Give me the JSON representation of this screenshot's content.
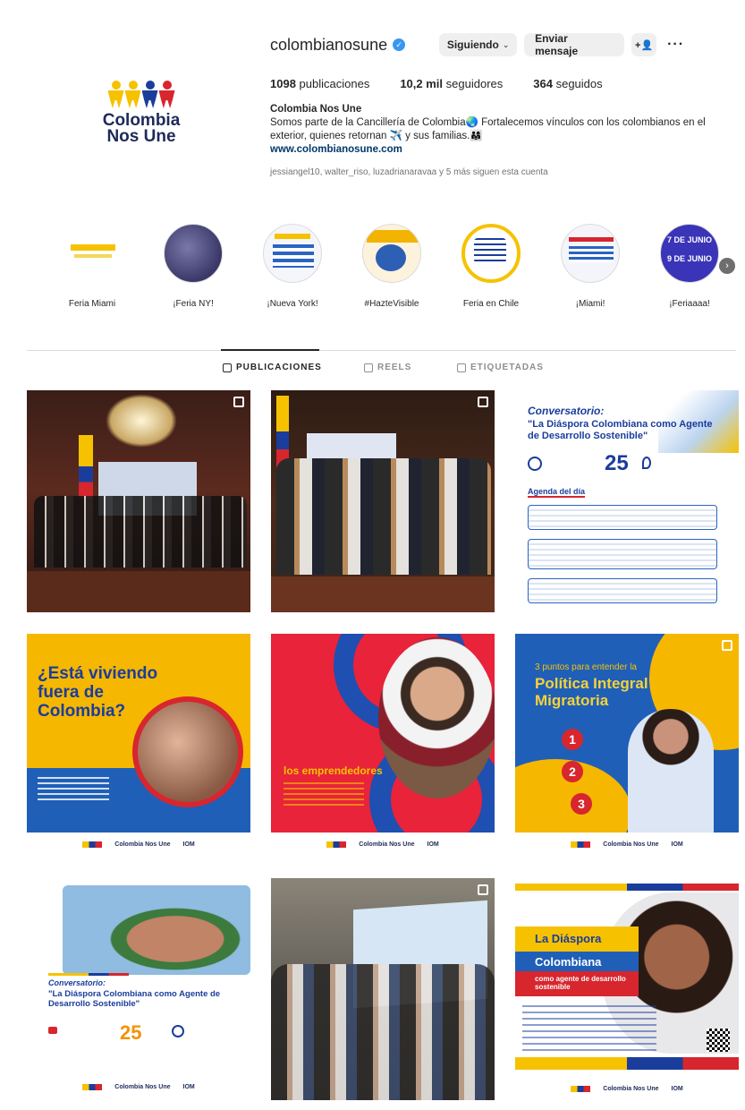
{
  "profile": {
    "username": "colombianosune",
    "follow_button": "Siguiendo",
    "message_button": "Enviar mensaje",
    "add_person_icon": "person-add-icon",
    "more_icon": "more-icon",
    "avatar_text_line1": "Colombia",
    "avatar_text_line2": "Nos Une",
    "stats": {
      "posts_count": "1098",
      "posts_label": "publicaciones",
      "followers_count": "10,2 mil",
      "followers_label": "seguidores",
      "following_count": "364",
      "following_label": "seguidos"
    },
    "bio_name": "Colombia Nos Une",
    "bio_text": "Somos parte de la Cancillería de Colombia🌏 Fortalecemos vínculos con los colombianos en el exterior, quienes retornan ✈️ y sus familias.👨‍👩‍👧",
    "bio_link": "www.colombianosune.com",
    "followed_by": "jessiangel10, walter_riso, luzadrianaravaa y 5 más siguen esta cuenta"
  },
  "highlights": [
    {
      "label": "Feria Miami"
    },
    {
      "label": "¡Feria NY!"
    },
    {
      "label": "¡Nueva York!"
    },
    {
      "label": "#HazteVisible"
    },
    {
      "label": "Feria en Chile"
    },
    {
      "label": "¡Miami!"
    },
    {
      "label": "¡Feriaaaa!"
    }
  ],
  "highlight_texts": {
    "h7_line1": "7 DE JUNIO",
    "h7_line2": "9 DE JUNIO"
  },
  "tabs": [
    {
      "label": "PUBLICACIONES",
      "icon": "grid-icon"
    },
    {
      "label": "REELS",
      "icon": "reels-icon"
    },
    {
      "label": "ETIQUETADAS",
      "icon": "tagged-icon"
    }
  ],
  "posts": {
    "p3_title_label": "Conversatorio:",
    "p3_title": "\"La Diáspora Colombiana como Agente de Desarrollo Sostenible\"",
    "p3_date_num": "25",
    "p3_agenda": "Agenda del día",
    "p4_title": "¿Está viviendo fuera de Colombia?",
    "p5_title": "los emprendedores",
    "p6_title_small": "3 puntos para entender la",
    "p6_title": "Política Integral Migratoria",
    "p6_n1": "1",
    "p6_n2": "2",
    "p6_n3": "3",
    "p7_title_label": "Conversatorio:",
    "p7_title": "\"La Diáspora Colombiana como Agente de Desarrollo Sostenible\"",
    "p7_date_num": "25",
    "p9_title1": "La Diáspora",
    "p9_title2": "Colombiana",
    "p9_title3": "como agente de desarrollo sostenible",
    "logo_text": "Colombia Nos Une",
    "iom_text": "IOM"
  },
  "colors": {
    "verified": "#3897f0",
    "link": "#00376b",
    "brand_yellow": "#f6c200",
    "brand_blue": "#1a5fb4",
    "brand_red": "#d7262e"
  }
}
